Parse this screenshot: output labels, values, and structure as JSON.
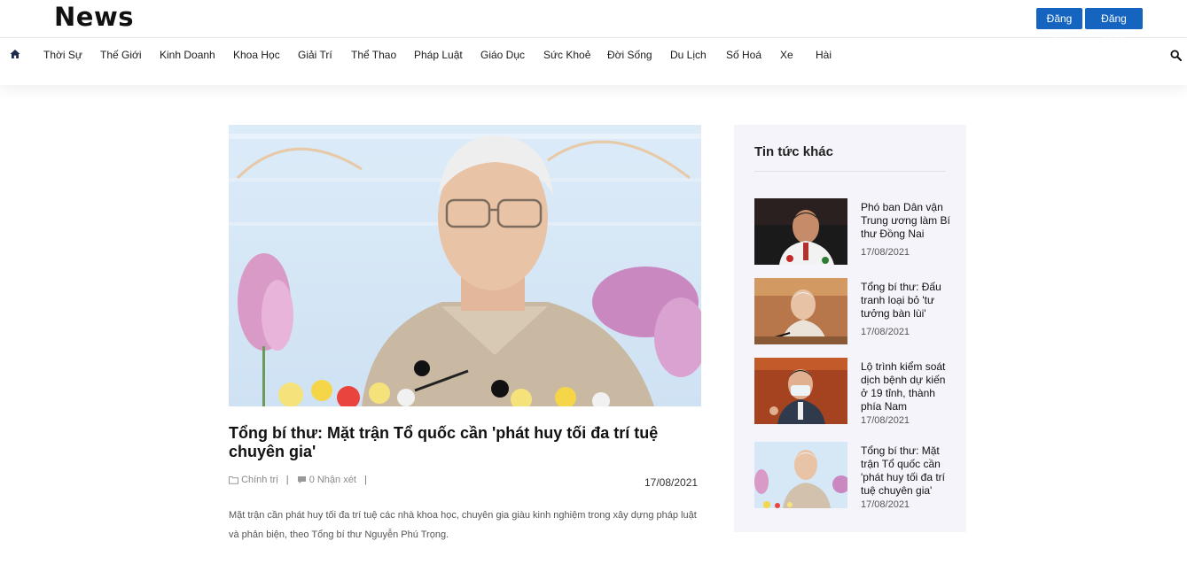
{
  "header": {
    "logo": "News",
    "register_label": "Đăng ký",
    "login_label": "Đăng nhập"
  },
  "nav": {
    "items": [
      "Thời Sự",
      "Thế Giới",
      "Kinh Doanh",
      "Khoa Học",
      "Giải Trí",
      "Thể Thao",
      "Pháp Luật",
      "Giáo Dục",
      "Sức Khoẻ",
      "Đời Sống",
      "Du Lịch",
      "Số Hoá",
      "Xe",
      "Hài"
    ],
    "home_icon": "home-icon",
    "search_icon": "search-icon"
  },
  "article": {
    "title": "Tổng bí thư: Mặt trận Tổ quốc cần 'phát huy tối đa trí tuệ chuyên gia'",
    "category": "Chính trị",
    "comments": "0 Nhận xét",
    "date": "17/08/2021",
    "summary": "Mặt trận cần phát huy tối đa trí tuệ các nhà khoa học, chuyên gia giàu kinh nghiệm trong xây dựng pháp luật và phản biện, theo Tổng bí thư Nguyễn Phú Trọng."
  },
  "sidebar": {
    "title": "Tin tức khác",
    "items": [
      {
        "title": "Phó ban Dân vận Trung ương làm Bí thư Đồng Nai",
        "date": "17/08/2021"
      },
      {
        "title": "Tổng bí thư: Đấu tranh loại bỏ 'tư tưởng bàn lùi'",
        "date": "17/08/2021"
      },
      {
        "title": "Lộ trình kiểm soát dịch bệnh dự kiến ở 19 tỉnh, thành phía Nam",
        "date": "17/08/2021"
      },
      {
        "title": "Tổng bí thư: Mặt trận Tổ quốc cần 'phát huy tối đa trí tuệ chuyên gia'",
        "date": "17/08/2021"
      }
    ]
  },
  "colors": {
    "accent": "#1565c0",
    "sidebar_bg": "#f6f4fb"
  }
}
